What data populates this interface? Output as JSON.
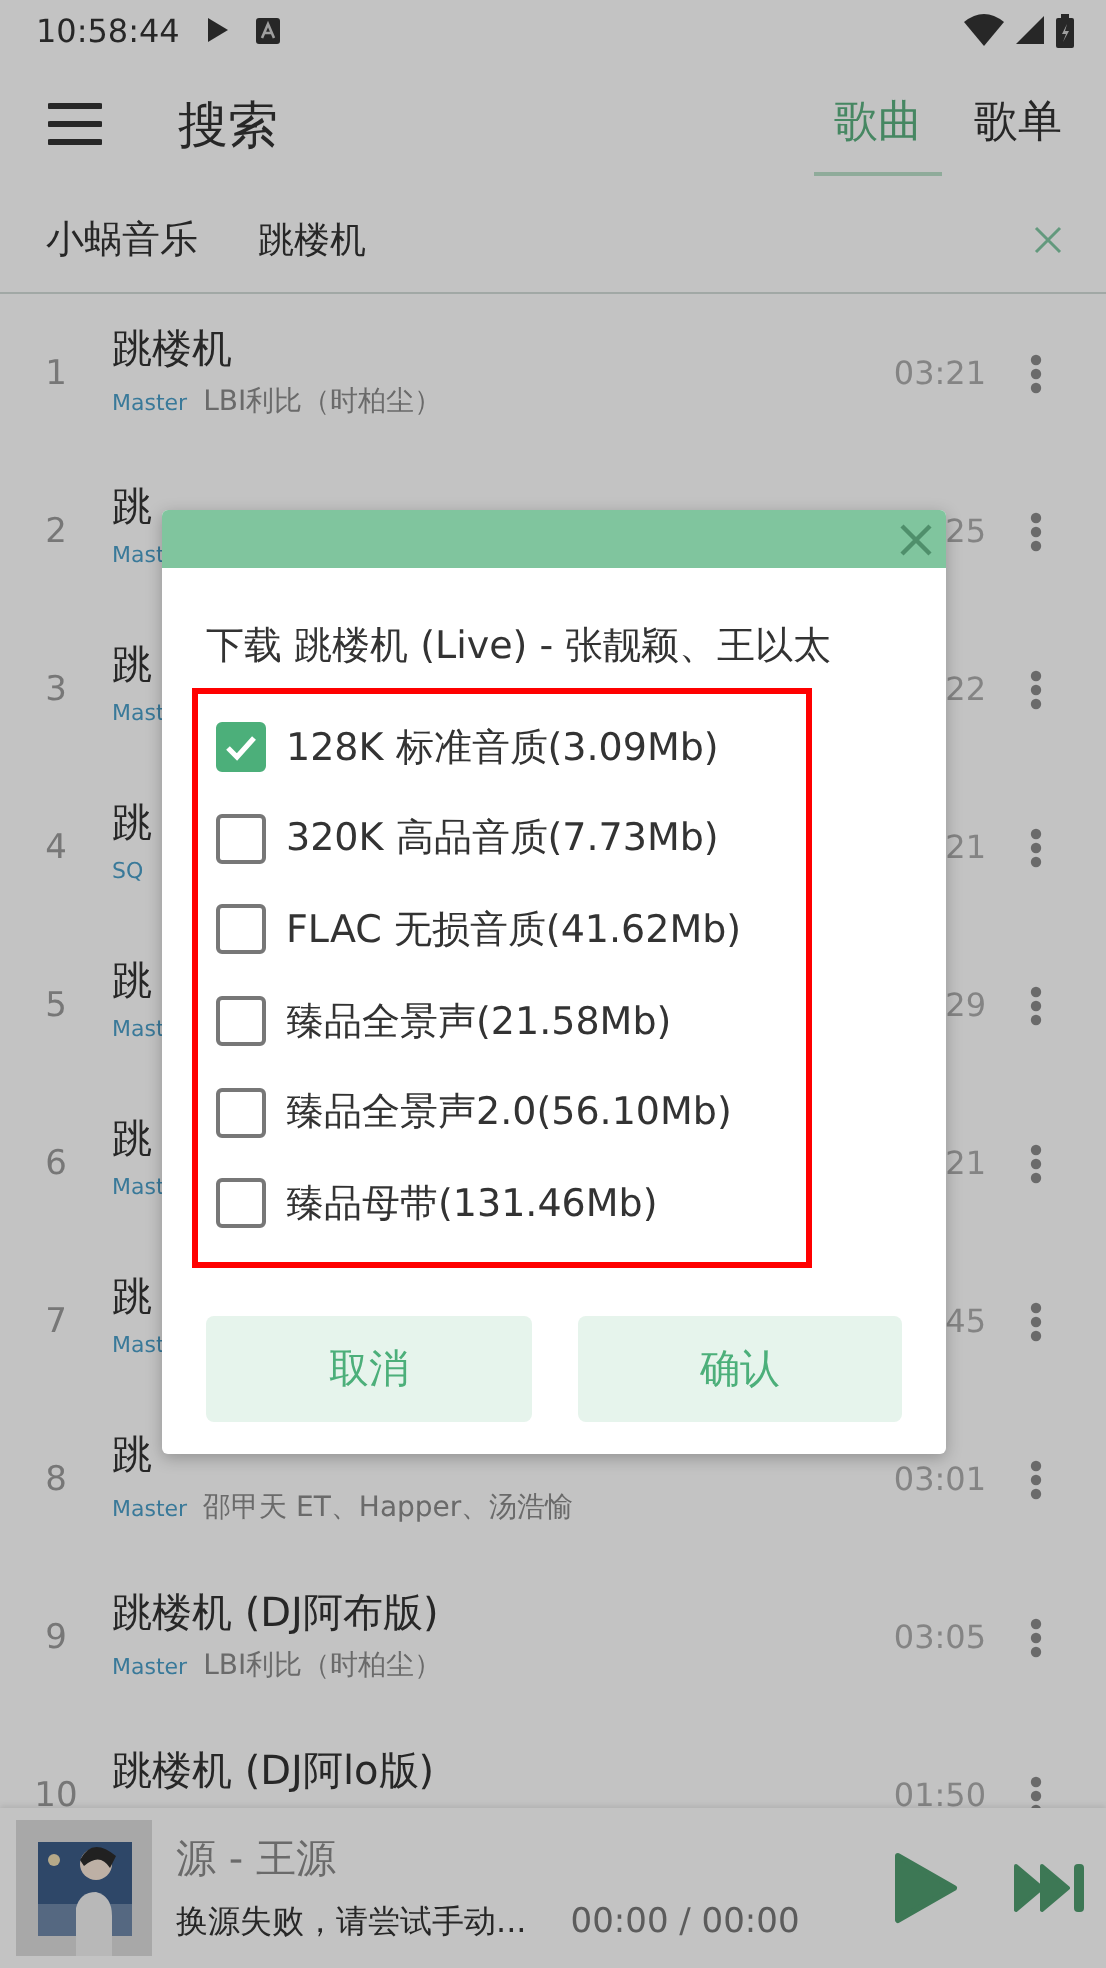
{
  "status_bar": {
    "time": "10:58:44"
  },
  "toolbar": {
    "title": "搜索",
    "tabs": [
      {
        "label": "歌曲",
        "selected": true
      },
      {
        "label": "歌单",
        "selected": false
      }
    ]
  },
  "search": {
    "source": "小蜗音乐",
    "value": "跳楼机"
  },
  "songs": [
    {
      "index": "1",
      "title": "跳楼机",
      "tag": "Master",
      "artist": "LBI利比（时柏尘）",
      "duration": "03:21"
    },
    {
      "index": "2",
      "title": "跳",
      "tag": "Mast",
      "duration": "25"
    },
    {
      "index": "3",
      "title": "跳",
      "tag": "Mast",
      "duration": "22"
    },
    {
      "index": "4",
      "title": "跳",
      "tag": "SQ",
      "duration": "21"
    },
    {
      "index": "5",
      "title": "跳",
      "tag": "Mast",
      "duration": "29"
    },
    {
      "index": "6",
      "title": "跳",
      "tag": "Mast",
      "duration": "21"
    },
    {
      "index": "7",
      "title": "跳",
      "tag": "Mast",
      "duration": "45"
    },
    {
      "index": "8",
      "title": "跳",
      "tag": "Master",
      "artist": "邵甲天 ET、Happer、汤浩愉",
      "duration": "03:01"
    },
    {
      "index": "9",
      "title": "跳楼机 (DJ阿布版)",
      "tag": "Master",
      "artist": "LBI利比（时柏尘）",
      "duration": "03:05"
    },
    {
      "index": "10",
      "title": "跳楼机 (DJ阿lo版)",
      "duration": "01:50"
    }
  ],
  "dialog": {
    "title": "下载 跳楼机 (Live) - 张靓颖、王以太",
    "options": [
      {
        "label": "128K 标准音质(3.09Mb)",
        "checked": true
      },
      {
        "label": "320K 高品音质(7.73Mb)",
        "checked": false
      },
      {
        "label": "FLAC 无损音质(41.62Mb)",
        "checked": false
      },
      {
        "label": "臻品全景声(21.58Mb)",
        "checked": false
      },
      {
        "label": "臻品全景声2.0(56.10Mb)",
        "checked": false
      },
      {
        "label": "臻品母带(131.46Mb)",
        "checked": false
      }
    ],
    "buttons": [
      "取消",
      "确认"
    ]
  },
  "player": {
    "title": "源 - 王源",
    "status": "换源失败，请尝试手动...",
    "time": "00:00 / 00:00"
  }
}
